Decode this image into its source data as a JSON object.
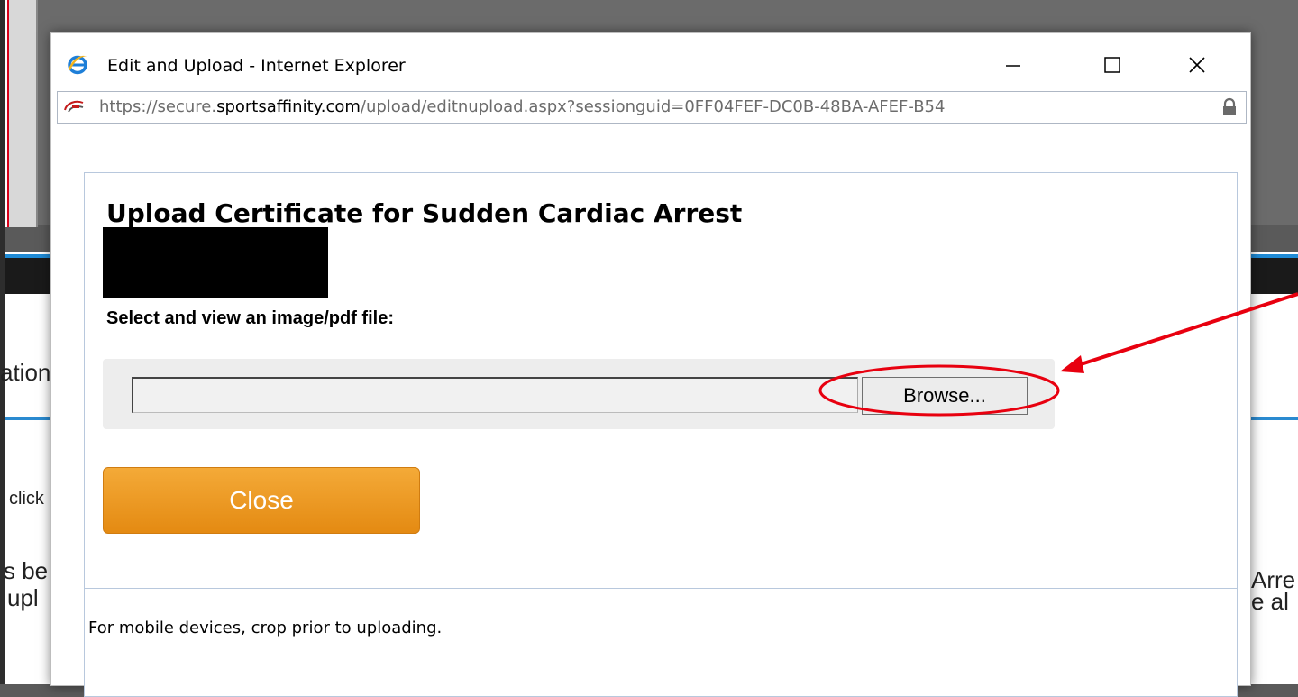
{
  "window": {
    "title": "Edit and Upload - Internet Explorer",
    "url_prefix": "https://secure.",
    "url_domain": "sportsaffinity.com",
    "url_path": "/upload/editnupload.aspx?sessionguid=0FF04FEF-DC0B-48BA-AFEF-B54",
    "minimize_glyph": "—",
    "maximize_glyph": "☐",
    "close_glyph": "✕"
  },
  "upload": {
    "heading": "Upload Certificate for Sudden Cardiac Arrest",
    "select_label": "Select and view an image/pdf file:",
    "file_path_value": "",
    "browse_label": "Browse...",
    "close_label": "Close",
    "mobile_note": "For mobile devices, crop prior to uploading."
  },
  "background_page": {
    "fragments": [
      "ation",
      "click",
      "s be",
      "upl",
      "Arre",
      "e al"
    ]
  },
  "colors": {
    "close_button": "#f0a02a",
    "annotation": "#e8000f",
    "frame_border": "#b8c8dd"
  },
  "icons": {
    "browser": "ie-logo-icon",
    "favicon": "site-favicon-icon",
    "lock": "lock-icon"
  }
}
